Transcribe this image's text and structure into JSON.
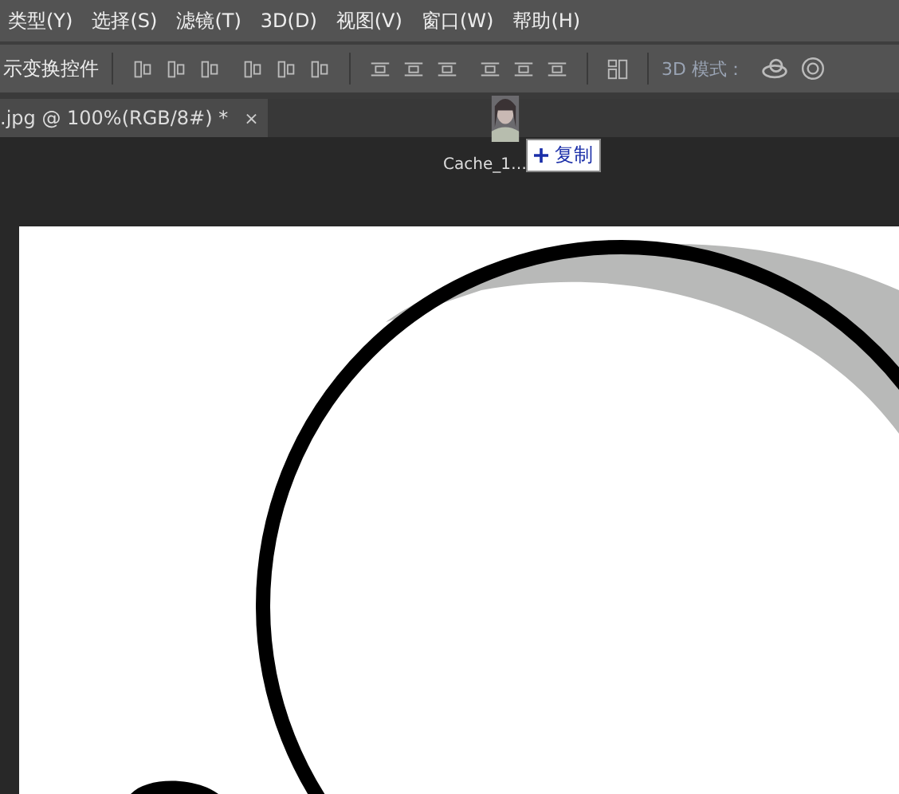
{
  "menu": [
    {
      "label": "类型(Y)"
    },
    {
      "label": "选择(S)"
    },
    {
      "label": "滤镜(T)"
    },
    {
      "label": "3D(D)"
    },
    {
      "label": "视图(V)"
    },
    {
      "label": "窗口(W)"
    },
    {
      "label": "帮助(H)"
    }
  ],
  "options_bar": {
    "transform_label": "示变换控件",
    "mode_label": "3D 模式："
  },
  "document_tab": {
    "title": ".jpg @ 100%(RGB/8#) *",
    "close": "×"
  },
  "drag": {
    "filename": "Cache_1…",
    "tooltip": "复制"
  }
}
